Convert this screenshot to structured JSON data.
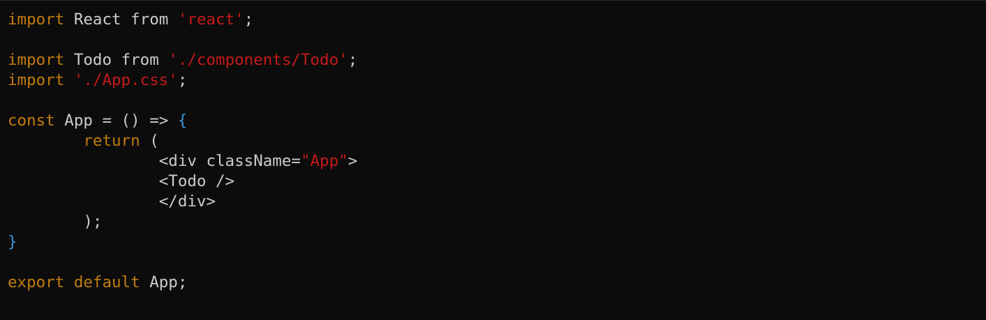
{
  "editor": {
    "colors": {
      "background": "#0c0c0c",
      "default_text": "#cccccc",
      "keyword": "#c27c0e",
      "string": "#c41a1a",
      "brace": "#3a96dd"
    },
    "lines": [
      [
        {
          "text": "import",
          "type": "keyword"
        },
        {
          "text": " React ",
          "type": "plain"
        },
        {
          "text": "from",
          "type": "plain"
        },
        {
          "text": " ",
          "type": "plain"
        },
        {
          "text": "'react'",
          "type": "string"
        },
        {
          "text": ";",
          "type": "plain"
        }
      ],
      [],
      [
        {
          "text": "import",
          "type": "keyword"
        },
        {
          "text": " Todo ",
          "type": "plain"
        },
        {
          "text": "from",
          "type": "plain"
        },
        {
          "text": " ",
          "type": "plain"
        },
        {
          "text": "'./components/Todo'",
          "type": "string"
        },
        {
          "text": ";",
          "type": "plain"
        }
      ],
      [
        {
          "text": "import",
          "type": "keyword"
        },
        {
          "text": " ",
          "type": "plain"
        },
        {
          "text": "'./App.css'",
          "type": "string"
        },
        {
          "text": ";",
          "type": "plain"
        }
      ],
      [],
      [
        {
          "text": "const",
          "type": "keyword"
        },
        {
          "text": " App = () => ",
          "type": "plain"
        },
        {
          "text": "{",
          "type": "brace"
        }
      ],
      [
        {
          "text": "        ",
          "type": "plain"
        },
        {
          "text": "return",
          "type": "keyword"
        },
        {
          "text": " (",
          "type": "plain"
        }
      ],
      [
        {
          "text": "                <div className=",
          "type": "plain"
        },
        {
          "text": "\"App\"",
          "type": "string"
        },
        {
          "text": ">",
          "type": "plain"
        }
      ],
      [
        {
          "text": "                <Todo />",
          "type": "plain"
        }
      ],
      [
        {
          "text": "                </div>",
          "type": "plain"
        }
      ],
      [
        {
          "text": "        );",
          "type": "plain"
        }
      ],
      [
        {
          "text": "}",
          "type": "brace"
        }
      ],
      [],
      [
        {
          "text": "export",
          "type": "keyword"
        },
        {
          "text": " ",
          "type": "plain"
        },
        {
          "text": "default",
          "type": "keyword"
        },
        {
          "text": " App;",
          "type": "plain"
        }
      ]
    ]
  }
}
